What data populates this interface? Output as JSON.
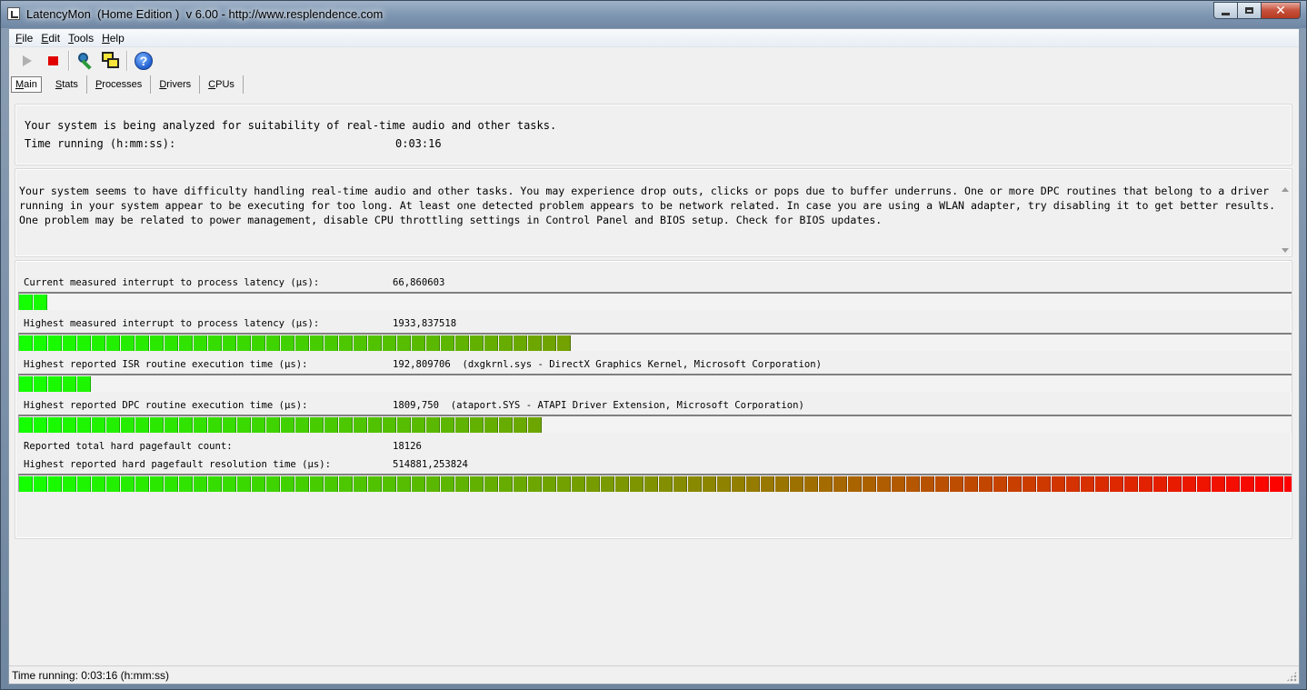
{
  "window": {
    "title": "LatencyMon  (Home Edition )  v 6.00 - http://www.resplendence.com",
    "close_symbol": "✕"
  },
  "menu": [
    {
      "accel": "F",
      "rest": "ile"
    },
    {
      "accel": "E",
      "rest": "dit"
    },
    {
      "accel": "T",
      "rest": "ools"
    },
    {
      "accel": "H",
      "rest": "elp"
    }
  ],
  "toolbar": {
    "icons": [
      "play-icon",
      "stop-icon",
      "analyze-icon",
      "windows-icon",
      "help-icon"
    ],
    "help_symbol": "?"
  },
  "tabs": [
    {
      "accel": "M",
      "rest": "ain"
    },
    {
      "accel": "S",
      "rest": "tats"
    },
    {
      "accel": "P",
      "rest": "rocesses"
    },
    {
      "accel": "D",
      "rest": "rivers"
    },
    {
      "accel": "C",
      "rest": "PUs"
    }
  ],
  "status_panel": {
    "line1": "Your system is being analyzed for suitability of real-time audio and other tasks.",
    "time_label": "Time running (h:mm:ss):",
    "time_value": "0:03:16"
  },
  "conclusion": {
    "text": "Your system seems to have difficulty handling real-time audio and other tasks. You may experience drop outs, clicks or pops due to buffer underruns. One or more DPC routines that belong to a driver running in your system appear to be executing for too long. At least one detected problem appears to be network related. In case you are using a WLAN adapter, try disabling it to get better results. One problem may be related to power management, disable CPU throttling settings in Control Panel and BIOS setup. Check for BIOS updates."
  },
  "measurements": {
    "current_latency": {
      "label": "Current measured interrupt to process latency (µs):",
      "value": "66,860603",
      "segments": 2
    },
    "highest_latency": {
      "label": "Highest measured interrupt to process latency (µs):",
      "value": "1933,837518",
      "segments": 38
    },
    "highest_isr": {
      "label": "Highest reported ISR routine execution time (µs):",
      "value": "192,809706  (dxgkrnl.sys - DirectX Graphics Kernel, Microsoft Corporation)",
      "segments": 5
    },
    "highest_dpc": {
      "label": "Highest reported DPC routine execution time (µs):",
      "value": "1809,750  (ataport.SYS - ATAPI Driver Extension, Microsoft Corporation)",
      "segments": 36
    },
    "pagefault_count": {
      "label": "Reported total hard pagefault count:",
      "value": "18126"
    },
    "pagefault_time": {
      "label": "Highest reported hard pagefault resolution time (µs):",
      "value": "514881,253824",
      "segments": 88
    }
  },
  "statusbar": {
    "text": "Time running: 0:03:16  (h:mm:ss)"
  }
}
